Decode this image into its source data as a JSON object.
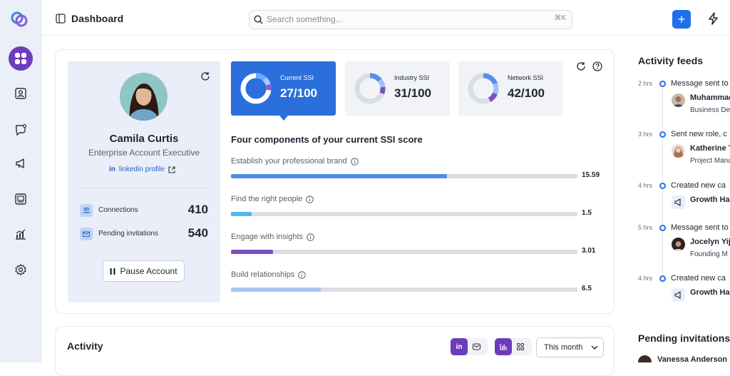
{
  "header": {
    "title": "Dashboard",
    "search_placeholder": "Search something...",
    "search_shortcut": "⌘K",
    "add_label": "+"
  },
  "sidebar": {
    "items": [
      {
        "icon": "grid-icon",
        "active": true
      },
      {
        "icon": "contact-card-icon",
        "active": false
      },
      {
        "icon": "chat-bubble-icon",
        "active": false
      },
      {
        "icon": "megaphone-icon",
        "active": false
      },
      {
        "icon": "inbox-icon",
        "active": false
      },
      {
        "icon": "bar-chart-icon",
        "active": false
      },
      {
        "icon": "settings-icon",
        "active": false
      }
    ]
  },
  "profile": {
    "name": "Camila Curtis",
    "role": "Enterprise Account Executive",
    "link_prefix": "in",
    "link_label": "linkedin profile",
    "stats": [
      {
        "label": "Connections",
        "value": "410"
      },
      {
        "label": "Pending invitations",
        "value": "540"
      }
    ],
    "pause_label": "Pause Account"
  },
  "ssi": {
    "tiles": [
      {
        "label": "Current SSI",
        "value": "27/100",
        "score": 27
      },
      {
        "label": "Industry SSI",
        "value": "31/100",
        "score": 31
      },
      {
        "label": "Network SSI",
        "value": "42/100",
        "score": 42
      }
    ],
    "components_title": "Four components of your current SSI score",
    "components": [
      {
        "label": "Establish your professional brand",
        "value": "15.59",
        "score": 15.59,
        "max": 25,
        "color": "#4f8ce8"
      },
      {
        "label": "Find the right people",
        "value": "1.5",
        "score": 1.5,
        "max": 25,
        "color": "#4fb8ee"
      },
      {
        "label": "Engage with insights",
        "value": "3.01",
        "score": 3.01,
        "max": 25,
        "color": "#7b4fc0"
      },
      {
        "label": "Build relationships",
        "value": "6.5",
        "score": 6.5,
        "max": 25,
        "color": "#a9c6f1"
      }
    ]
  },
  "activity": {
    "title": "Activity",
    "channel_left": "in",
    "period": "This month"
  },
  "feeds": {
    "title": "Activity feeds",
    "items": [
      {
        "time": "2 hrs",
        "text": "Message sent to",
        "name": "Muhammad",
        "sub": "Business Dev",
        "kind": "person"
      },
      {
        "time": "3 hrs",
        "text": "Sent new role, c",
        "name": "Katherine T",
        "sub": "Project Mana",
        "kind": "person"
      },
      {
        "time": "4 hrs",
        "text": "Created new ca",
        "name": "Growth Ha",
        "sub": "",
        "kind": "campaign"
      },
      {
        "time": "5 hrs",
        "text": "Message sent to",
        "name": "Jocelyn Yij",
        "sub": "Founding M",
        "kind": "person"
      },
      {
        "time": "4 hrs",
        "text": "Created new ca",
        "name": "Growth Ha",
        "sub": "",
        "kind": "campaign"
      }
    ]
  },
  "pending": {
    "title": "Pending invitations",
    "first_name": "Vanessa Anderson"
  }
}
